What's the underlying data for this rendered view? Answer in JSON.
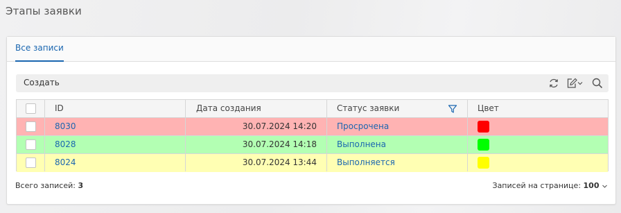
{
  "page": {
    "title": "Этапы заявки"
  },
  "tabs": [
    {
      "label": "Все записи",
      "active": true
    }
  ],
  "toolbar": {
    "create_label": "Создать",
    "icons": [
      "refresh-icon",
      "edit-icon",
      "chevron-down-icon",
      "search-icon"
    ]
  },
  "table": {
    "headers": {
      "id": "ID",
      "created": "Дата создания",
      "status": "Статус заявки",
      "color": "Цвет"
    },
    "rows": [
      {
        "id": "8030",
        "created": "30.07.2024 14:20",
        "status": "Просрочена",
        "row_bg": "#ffb3b3",
        "swatch": "#ff0000"
      },
      {
        "id": "8028",
        "created": "30.07.2024 14:18",
        "status": "Выполнена",
        "row_bg": "#b3ffb3",
        "swatch": "#00ff00"
      },
      {
        "id": "8024",
        "created": "30.07.2024 13:44",
        "status": "Выполняется",
        "row_bg": "#ffffb3",
        "swatch": "#ffff00"
      }
    ]
  },
  "footer": {
    "total_label": "Всего записей:",
    "total_value": "3",
    "per_page_label": "Записей на странице:",
    "per_page_value": "100"
  },
  "colors": {
    "accent": "#1a66b0"
  }
}
